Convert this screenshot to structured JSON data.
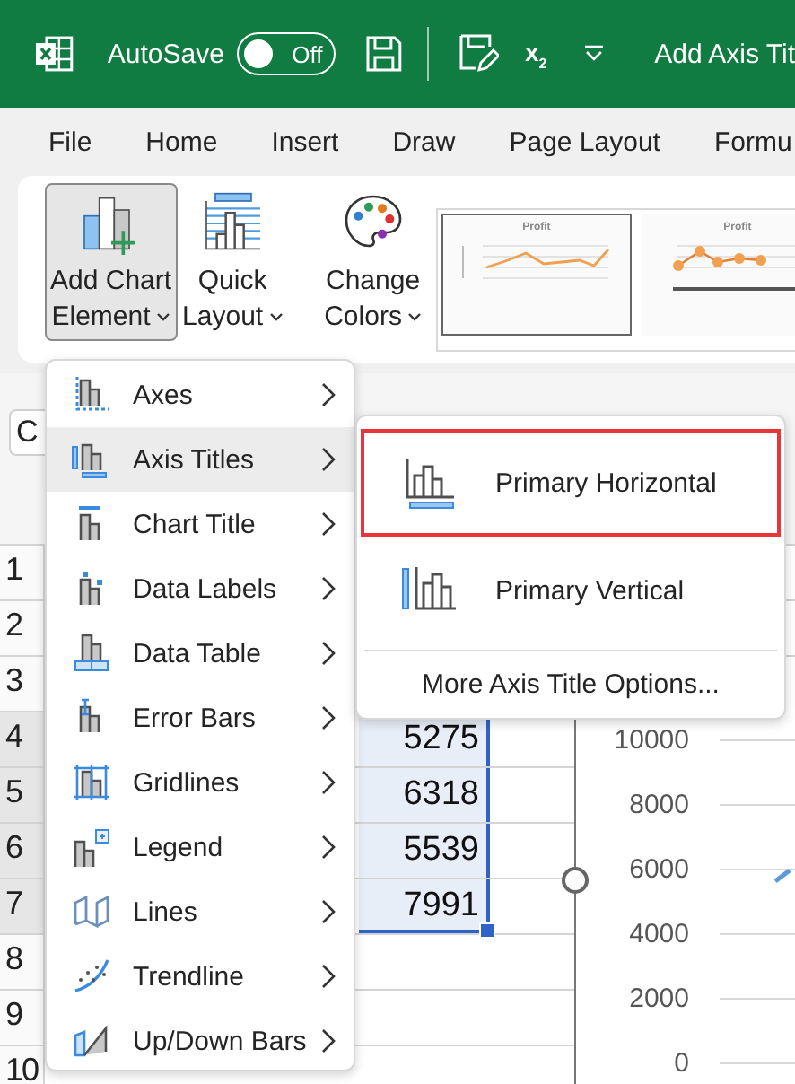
{
  "title_bar": {
    "autosave": {
      "label": "AutoSave",
      "state_text": "Off",
      "on": false
    },
    "subscript_button": "x$_{2}$",
    "document_title": "Add Axis Tit"
  },
  "tabs": [
    {
      "label": "File",
      "selected": false
    },
    {
      "label": "Home",
      "selected": false
    },
    {
      "label": "Insert",
      "selected": false
    },
    {
      "label": "Draw",
      "selected": false
    },
    {
      "label": "Page Layout",
      "selected": false
    },
    {
      "label": "Formu",
      "selected": false
    }
  ],
  "ribbon": {
    "buttons": [
      {
        "label_lines": [
          "Add Chart",
          "Element"
        ],
        "kind": "add-chart-element",
        "pressed": true
      },
      {
        "label_lines": [
          "Quick",
          "Layout"
        ],
        "kind": "quick-layout",
        "pressed": false
      },
      {
        "label_lines": [
          "Change",
          "Colors"
        ],
        "kind": "change-colors",
        "pressed": false
      }
    ],
    "chart_styles": [
      {
        "title": "Profit",
        "selected": true,
        "kind": "line"
      },
      {
        "title": "Profit",
        "selected": false,
        "kind": "markers"
      }
    ]
  },
  "name_box": {
    "value": "C"
  },
  "rows": [
    {
      "number": "1",
      "selected": false
    },
    {
      "number": "2",
      "selected": false
    },
    {
      "number": "3",
      "selected": false
    },
    {
      "number": "4",
      "value": "5275",
      "selected": true
    },
    {
      "number": "5",
      "value": "6318",
      "selected": true
    },
    {
      "number": "6",
      "value": "5539",
      "selected": true
    },
    {
      "number": "7",
      "value": "7991",
      "selected": true
    },
    {
      "number": "8",
      "selected": false
    },
    {
      "number": "9",
      "selected": false
    },
    {
      "number": "10",
      "selected": false
    }
  ],
  "chart": {
    "y_axis_labels": [
      "10000",
      "8000",
      "6000",
      "4000",
      "2000",
      "0"
    ]
  },
  "menu": {
    "items": [
      {
        "label": "Axes",
        "kind": "axes",
        "highlighted": false
      },
      {
        "label": "Axis Titles",
        "kind": "axis-titles",
        "highlighted": true
      },
      {
        "label": "Chart Title",
        "kind": "chart-title",
        "highlighted": false
      },
      {
        "label": "Data Labels",
        "kind": "data-labels",
        "highlighted": false
      },
      {
        "label": "Data Table",
        "kind": "data-table",
        "highlighted": false
      },
      {
        "label": "Error Bars",
        "kind": "error-bars",
        "highlighted": false
      },
      {
        "label": "Gridlines",
        "kind": "gridlines",
        "highlighted": false
      },
      {
        "label": "Legend",
        "kind": "legend",
        "highlighted": false
      },
      {
        "label": "Lines",
        "kind": "lines",
        "highlighted": false
      },
      {
        "label": "Trendline",
        "kind": "trendline",
        "highlighted": false
      },
      {
        "label": "Up/Down Bars",
        "kind": "up-down-bars",
        "highlighted": false
      }
    ]
  },
  "submenu": {
    "items": [
      {
        "label": "Primary Horizontal",
        "kind": "horizontal",
        "focused": true
      },
      {
        "label": "Primary Vertical",
        "kind": "vertical",
        "focused": false
      }
    ],
    "footer": "More Axis Title Options..."
  }
}
